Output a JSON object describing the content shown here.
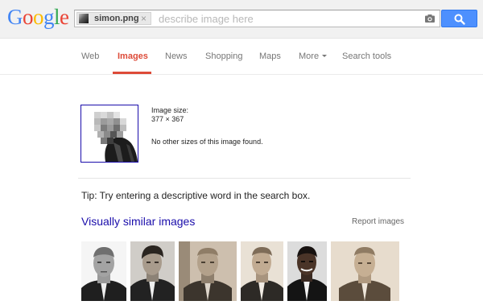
{
  "header": {
    "logo_letters": [
      {
        "ch": "G",
        "color": "#4285f4"
      },
      {
        "ch": "o",
        "color": "#ea4335"
      },
      {
        "ch": "o",
        "color": "#fbbc05"
      },
      {
        "ch": "g",
        "color": "#4285f4"
      },
      {
        "ch": "l",
        "color": "#34a853"
      },
      {
        "ch": "e",
        "color": "#ea4335"
      }
    ],
    "chip_filename": "simon.png",
    "chip_close": "×",
    "search_placeholder": "describe image here",
    "search_value": ""
  },
  "nav": {
    "items": [
      {
        "label": "Web",
        "active": false
      },
      {
        "label": "Images",
        "active": true
      },
      {
        "label": "News",
        "active": false
      },
      {
        "label": "Shopping",
        "active": false
      },
      {
        "label": "Maps",
        "active": false
      },
      {
        "label": "More",
        "active": false,
        "has_caret": true
      },
      {
        "label": "Search tools",
        "active": false
      }
    ]
  },
  "image_info": {
    "size_label": "Image size:",
    "size_value": "377 × 367",
    "other_sizes": "No other sizes of this image found."
  },
  "tip": "Tip: Try entering a descriptive word in the search box.",
  "similar": {
    "title": "Visually similar images",
    "report_label": "Report images",
    "images": [
      {
        "name": "similar-image-1"
      },
      {
        "name": "similar-image-2"
      },
      {
        "name": "similar-image-3"
      },
      {
        "name": "similar-image-4"
      },
      {
        "name": "similar-image-5"
      },
      {
        "name": "similar-image-6"
      }
    ]
  },
  "colors": {
    "accent_red": "#dd4b39",
    "link_blue": "#1a0dab",
    "search_button_blue": "#4d90fe"
  }
}
